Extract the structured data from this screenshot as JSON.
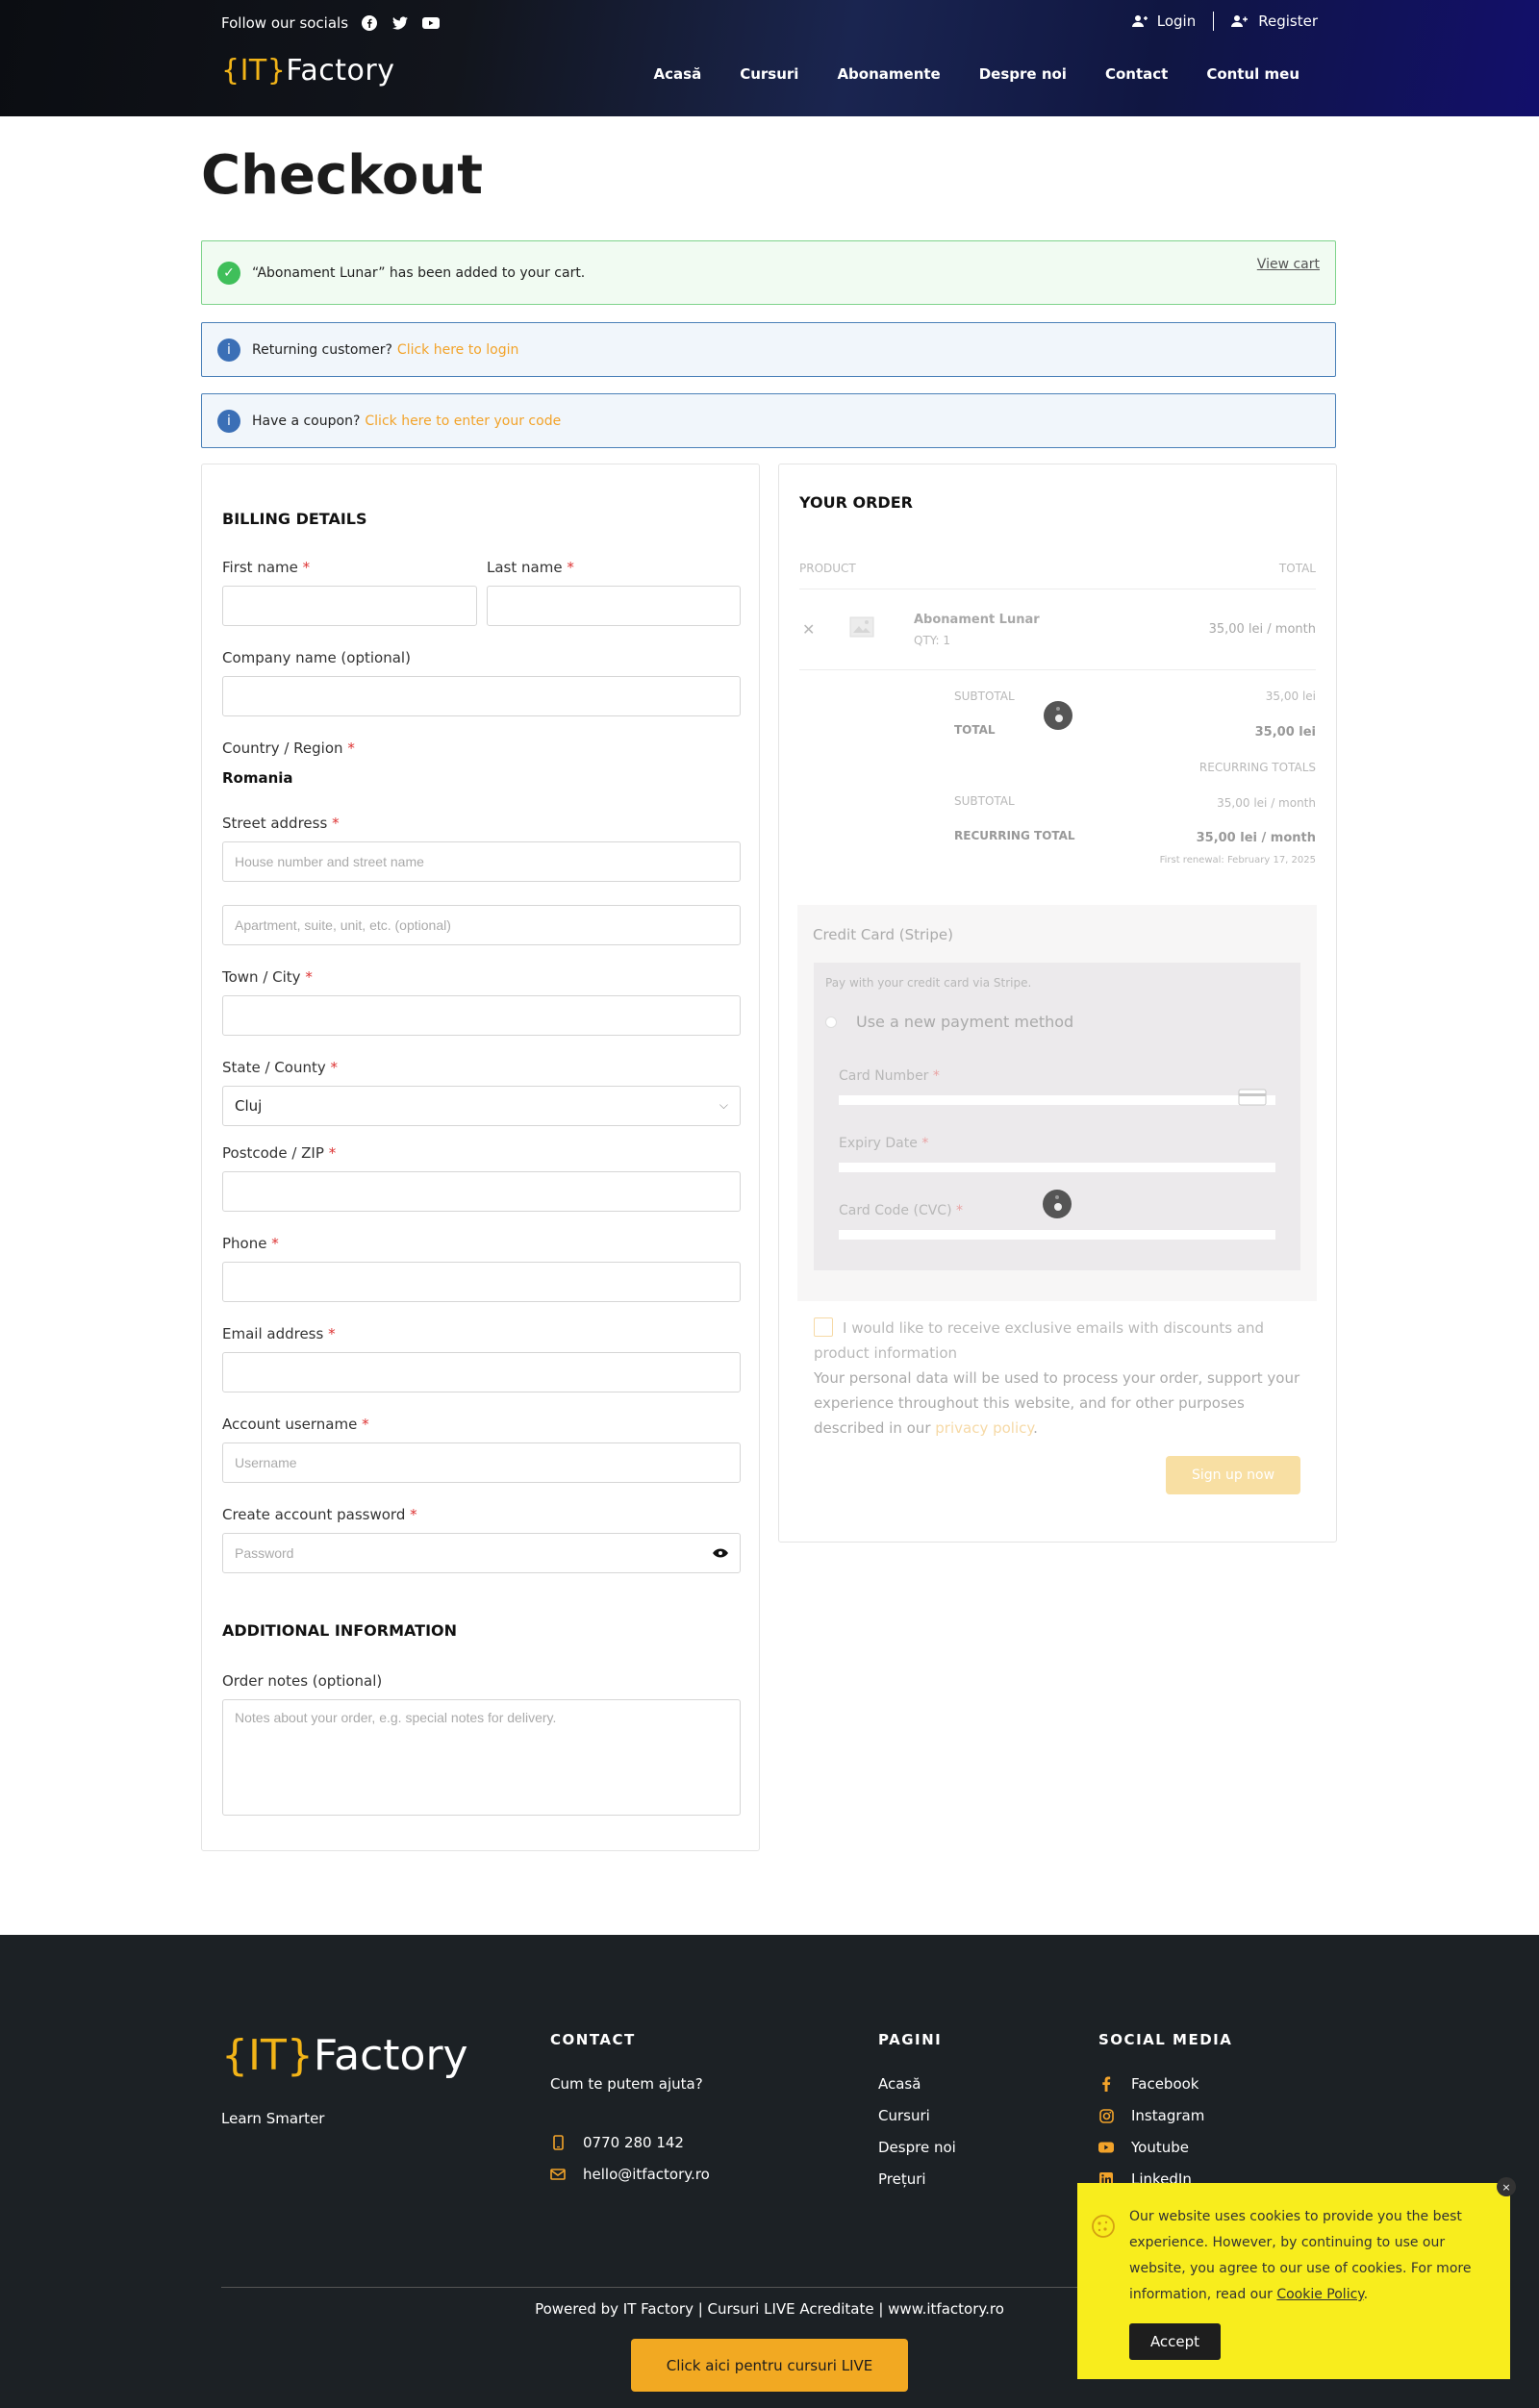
{
  "header": {
    "socials_label": "Follow our socials",
    "login": "Login",
    "register": "Register",
    "logo_bracket": "{IT}",
    "logo_text": "Factory",
    "nav": [
      "Acasă",
      "Cursuri",
      "Abonamente",
      "Despre noi",
      "Contact",
      "Contul meu"
    ]
  },
  "page_title": "Checkout",
  "notices": {
    "added": "“Abonament Lunar” has been added to your cart.",
    "view_cart": "View cart",
    "returning": "Returning customer?",
    "returning_link": "Click here to login",
    "coupon": "Have a coupon?",
    "coupon_link": "Click here to enter your code"
  },
  "billing": {
    "title": "Billing details",
    "first_name": "First name",
    "last_name": "Last name",
    "company": "Company name (optional)",
    "country": "Country / Region",
    "country_value": "Romania",
    "street": "Street address",
    "street_ph": "House number and street name",
    "street2_ph": "Apartment, suite, unit, etc. (optional)",
    "town": "Town / City",
    "state": "State / County",
    "state_value": "Cluj",
    "postcode": "Postcode / ZIP",
    "phone": "Phone",
    "email": "Email address",
    "username": "Account username",
    "username_ph": "Username",
    "password": "Create account password",
    "password_ph": "Password",
    "required_mark": "*"
  },
  "additional": {
    "title": "Additional information",
    "notes": "Order notes (optional)",
    "notes_ph": "Notes about your order, e.g. special notes for delivery."
  },
  "order": {
    "title": "YOUR ORDER",
    "col_product": "PRODUCT",
    "col_total": "TOTAL",
    "product_name": "Abonament Lunar",
    "qty_label": "QTY:",
    "qty_value": "1",
    "product_price": "35,00 lei / month",
    "subtotal_label": "SUBTOTAL",
    "subtotal_value": "35,00 lei",
    "total_label": "TOTAL",
    "total_value": "35,00 lei",
    "recurring_totals": "RECURRING TOTALS",
    "rec_subtotal_label": "SUBTOTAL",
    "rec_subtotal_value": "35,00 lei / month",
    "rec_total_label": "RECURRING TOTAL",
    "rec_total_value": "35,00 lei / month",
    "first_renewal": "First renewal: February 17, 2025",
    "payment_method": "Credit Card (Stripe)",
    "pay_desc": "Pay with your credit card via Stripe.",
    "new_method": "Use a new payment method",
    "card_number": "Card Number",
    "expiry": "Expiry Date",
    "cvc": "Card Code (CVC)",
    "newsletter": "I would like to receive exclusive emails with discounts and product information",
    "privacy_text": "Your personal data will be used to process your order, support your experience throughout this website, and for other purposes described in our",
    "privacy_link": "privacy policy",
    "signup": "Sign up now"
  },
  "footer": {
    "logo_bracket": "{IT}",
    "logo_text": "Factory",
    "tagline": "Learn Smarter",
    "contact_h": "CONTACT",
    "contact_q": "Cum te putem ajuta?",
    "phone": "0770 280 142",
    "email": "hello@itfactory.ro",
    "pages_h": "PAGINI",
    "pages": [
      "Acasă",
      "Cursuri",
      "Despre noi",
      "Prețuri"
    ],
    "social_h": "SOCIAL MEDIA",
    "social": [
      "Facebook",
      "Instagram",
      "Youtube",
      "LinkedIn"
    ],
    "powered": "Powered by IT Factory | Cursuri LIVE Acreditate | www.itfactory.ro",
    "cta": "Click aici pentru cursuri LIVE"
  },
  "cookie": {
    "text": "Our website uses cookies to provide you the best experience. However, by continuing to use our website, you agree to our use of cookies. For more information, read our",
    "policy": "Cookie Policy",
    "accept": "Accept",
    "close": "×"
  },
  "colors": {
    "accent": "#f2a32a",
    "logo_bracket": "#f2b418",
    "success": "#3fbf5a",
    "info": "#3b6fb6",
    "footer_bg": "#1c2125",
    "cookie_bg": "#f8ed1d"
  }
}
